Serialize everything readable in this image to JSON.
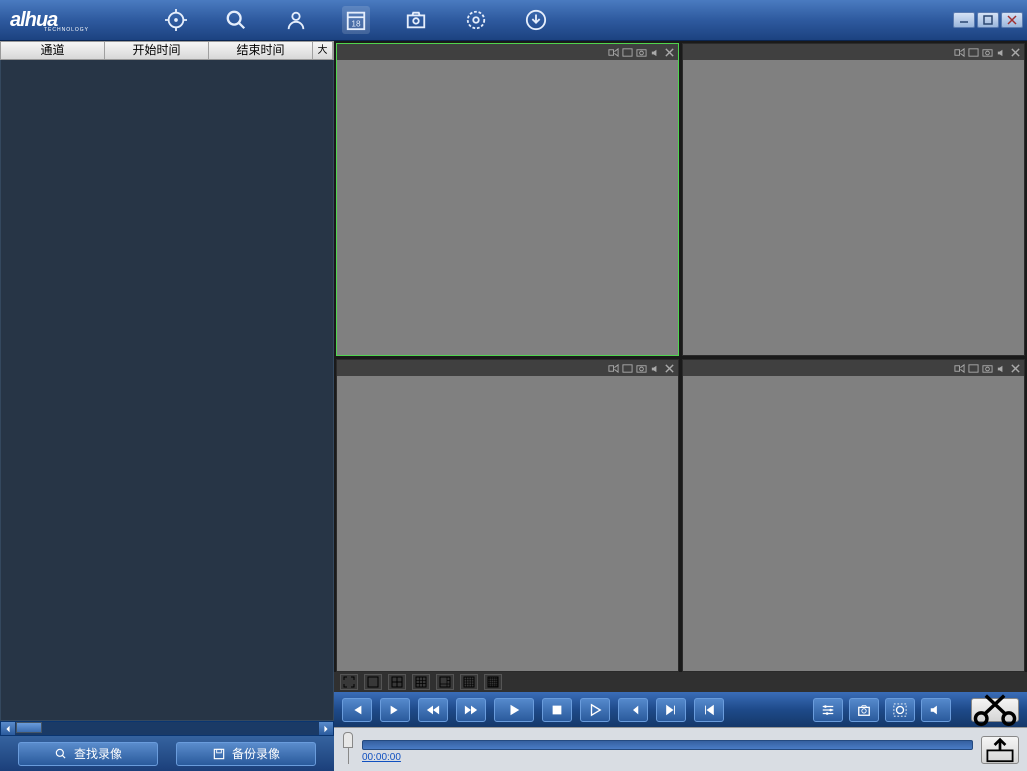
{
  "brand": "alhua",
  "brand_sub": "TECHNOLOGY",
  "sidebar": {
    "cols": [
      {
        "label": "通道"
      },
      {
        "label": "开始时间"
      },
      {
        "label": "结束时间"
      },
      {
        "label": "大"
      }
    ],
    "buttons": {
      "search": "查找录像",
      "backup": "备份录像"
    }
  },
  "timeline": {
    "time": "00:00:00"
  },
  "top_nav": {
    "calendar_day": "18"
  }
}
